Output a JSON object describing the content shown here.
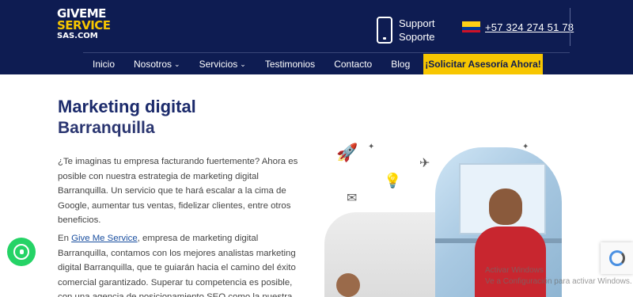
{
  "header": {
    "logo": {
      "line1": "GIVEME",
      "line2": "SERVICE",
      "line3": "SAS.COM"
    },
    "support": {
      "line1": "Support",
      "line2": "Soporte"
    },
    "phone": "+57 324 274 51 78",
    "nav": [
      {
        "label": "Inicio"
      },
      {
        "label": "Nosotros",
        "dropdown": "⌄"
      },
      {
        "label": "Servicios",
        "dropdown": "⌄"
      },
      {
        "label": "Testimonios"
      },
      {
        "label": "Contacto"
      },
      {
        "label": "Blog"
      }
    ],
    "cta": "¡Solicitar Asesoría Ahora!",
    "colors": {
      "navy": "#0e1c52",
      "accent": "#f7c600"
    }
  },
  "main": {
    "title": "Marketing digital",
    "subtitle": "Barranquilla",
    "para1": "¿Te imaginas tu empresa facturando fuertemente? Ahora es posible con nuestra estrategia de marketing digital Barranquilla. Un servicio que te hará escalar a la cima de Google, aumentar tus ventas, fidelizar clientes, entre otros beneficios.",
    "para2_before": "En ",
    "para2_link": "Give Me Service",
    "para2_after": ", empresa de marketing digital Barranquilla, contamos con los mejores analistas marketing digital Barranquilla, que te guiarán hacia el camino del éxito comercial garantizado. Superar tu competencia es posible, con una agencia de posicionamiento SEO como la nuestra."
  },
  "overlay": {
    "activate_title": "Activar Windows",
    "activate_sub": "Ve a Configuración para activar Windows."
  },
  "icons": [
    "phone-icon",
    "colombia-flag-icon",
    "whatsapp-icon",
    "recaptcha-icon",
    "rocket-icon",
    "lightbulb-icon",
    "paper-plane-icon",
    "envelope-icon"
  ]
}
